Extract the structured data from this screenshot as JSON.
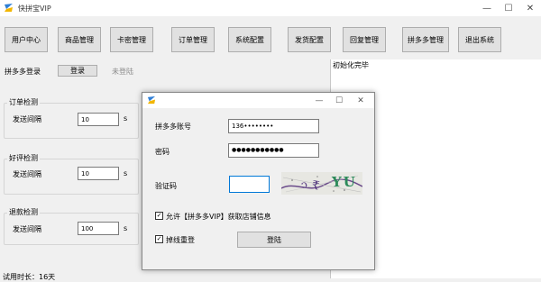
{
  "app": {
    "title": "快拼宝VIP",
    "controls": {
      "minimize": "—",
      "maximize": "☐",
      "close": "✕"
    }
  },
  "nav": {
    "buttons": [
      "用户中心",
      "商品管理",
      "卡密管理",
      "订单管理",
      "系统配置",
      "发货配置",
      "回复管理",
      "拼多多管理",
      "退出系统"
    ]
  },
  "login_row": {
    "label": "拼多多登录",
    "button": "登录",
    "status": "未登陆"
  },
  "groups": [
    {
      "title": "订单检测",
      "field_label": "发送间隔",
      "value": "10",
      "unit": "s"
    },
    {
      "title": "好评检测",
      "field_label": "发送间隔",
      "value": "10",
      "unit": "s"
    },
    {
      "title": "退款检测",
      "field_label": "发送间隔",
      "value": "100",
      "unit": "s"
    }
  ],
  "footer_text": "试用时长：16天",
  "log": {
    "text": "初始化完毕"
  },
  "dialog": {
    "controls": {
      "minimize": "—",
      "maximize": "☐",
      "close": "✕"
    },
    "account_label": "拼多多账号",
    "account_value": "136••••••••",
    "password_label": "密码",
    "password_value": "●●●●●●●●●●●",
    "captcha_label": "验证码",
    "captcha_input": "",
    "captcha_text": "YU",
    "allow_label": "允许【拼多多VIP】获取店铺信息",
    "allow_checked": true,
    "reconnect_label": "掉线重登",
    "reconnect_checked": true,
    "login_button": "登陆"
  },
  "colors": {
    "logo_blue": "#2f7fd6",
    "logo_yellow": "#f2b600",
    "window_bg": "#f0f0f0"
  }
}
